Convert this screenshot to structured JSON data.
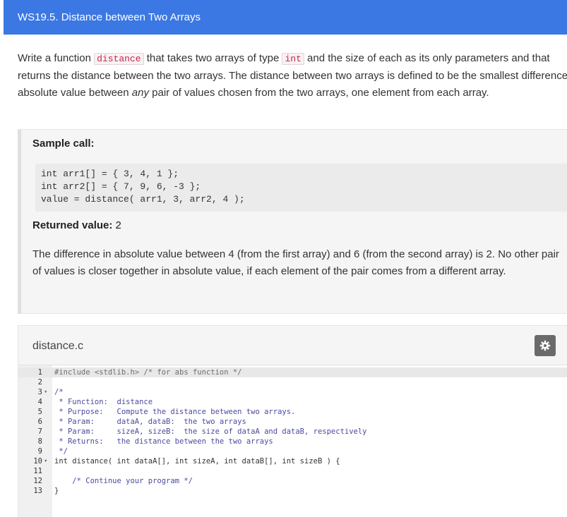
{
  "header": {
    "title": "WS19.5. Distance between Two Arrays"
  },
  "prompt": {
    "text_1": "Write a function ",
    "fn_name": "distance",
    "text_2": " that takes two arrays of type ",
    "type_name": "int",
    "text_3": " and the size of each as its only parameters and that returns the distance between the two arrays. The distance between two arrays is defined to be the smallest difference in absolute value between ",
    "emphasis": "any",
    "text_4": " pair of values chosen from the two arrays, one element from each array."
  },
  "sample": {
    "heading": "Sample call:",
    "code_lines": [
      "int arr1[] = { 3, 4, 1 };",
      "int arr2[] = { 7, 9, 6, -3 };",
      "value = distance( arr1, 3, arr2, 4 );"
    ],
    "returned_label": "Returned value:",
    "returned_value": "2",
    "explanation": "The difference in absolute value between 4 (from the first array) and 6 (from the second array) is 2. No other pair of values is closer together in absolute value, if each element of the pair comes from a different array."
  },
  "editor": {
    "file_name": "distance.c",
    "settings_icon": "gear-icon",
    "lines": [
      {
        "n": "1",
        "fold": "",
        "text": "#include <stdlib.h> /* for abs function */"
      },
      {
        "n": "2",
        "fold": "",
        "text": ""
      },
      {
        "n": "3",
        "fold": "▾",
        "text": "/*"
      },
      {
        "n": "4",
        "fold": "",
        "text": " * Function:  distance"
      },
      {
        "n": "5",
        "fold": "",
        "text": " * Purpose:   Compute the distance between two arrays."
      },
      {
        "n": "6",
        "fold": "",
        "text": " * Param:     dataA, dataB:  the two arrays"
      },
      {
        "n": "7",
        "fold": "",
        "text": " * Param:     sizeA, sizeB:  the size of dataA and dataB, respectively"
      },
      {
        "n": "8",
        "fold": "",
        "text": " * Returns:   the distance between the two arrays"
      },
      {
        "n": "9",
        "fold": "",
        "text": " */"
      },
      {
        "n": "10",
        "fold": "▾",
        "text": "int distance( int dataA[], int sizeA, int dataB[], int sizeB ) {"
      },
      {
        "n": "11",
        "fold": "",
        "text": ""
      },
      {
        "n": "12",
        "fold": "",
        "text": "    /* Continue your program */"
      },
      {
        "n": "13",
        "fold": "",
        "text": "}"
      }
    ]
  }
}
